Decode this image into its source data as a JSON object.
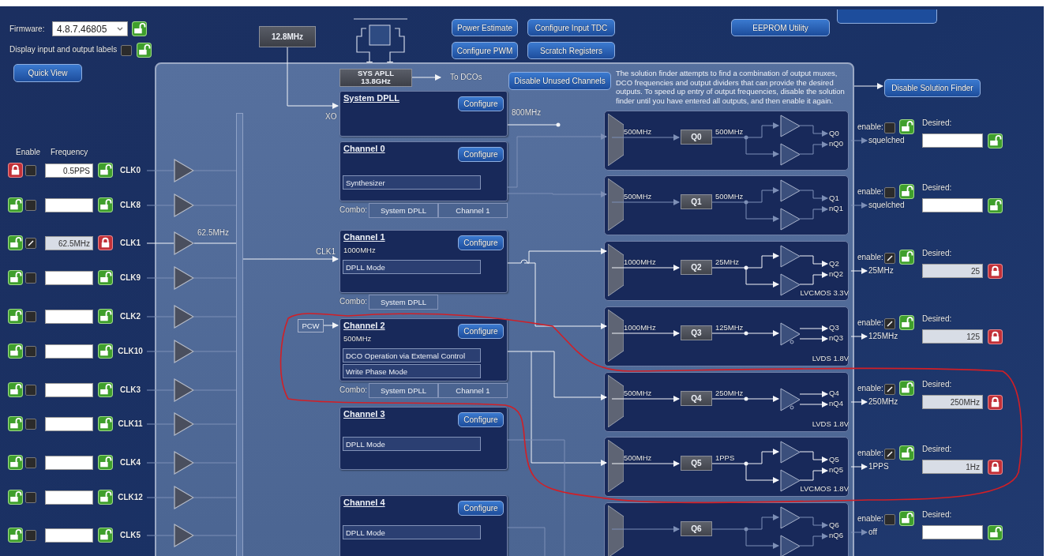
{
  "header": {
    "firmware_label": "Firmware:",
    "firmware_version": "4.8.7.46805",
    "firmware_locked": false,
    "labels_option": "Display input and output labels",
    "labels_checked": false,
    "labels_locked": false,
    "quick_view": "Quick View"
  },
  "top_buttons": [
    "Power Estimate",
    "Configure Input TDC",
    "EEPROM Utility",
    "Configure PWM",
    "Scratch Registers"
  ],
  "xo": {
    "frequency": "12.8MHz"
  },
  "sys_apll": {
    "name": "SYS APLL",
    "frequency": "13.8GHz",
    "output": "To DCOs"
  },
  "disable_unused": "Disable Unused Channels",
  "solution_finder": {
    "note": "The solution finder attempts to find a combination of output muxes, DCO frequencies and output dividers that can provide the desired outputs. To speed up entry of output frequencies, disable the solution finder until you have entered all outputs, and then enable it again.",
    "button": "Disable Solution Finder"
  },
  "inputs": {
    "enable_heading": "Enable",
    "frequency_heading": "Frequency",
    "rows": [
      {
        "label": "CLK0",
        "enable_locked": true,
        "enabled": false,
        "frequency": "0.5PPS",
        "frequency_locked": false
      },
      {
        "label": "CLK8",
        "enable_locked": false,
        "enabled": false,
        "frequency_locked": false
      },
      {
        "label": "CLK1",
        "enable_locked": false,
        "enabled": true,
        "frequency": "62.5MHz",
        "frequency_locked": true,
        "buffer_frequency": "62.5MHz"
      },
      {
        "label": "CLK9",
        "enable_locked": false,
        "enabled": false,
        "frequency_locked": false
      },
      {
        "label": "CLK2",
        "enable_locked": false,
        "enabled": false,
        "frequency_locked": false
      },
      {
        "label": "CLK10",
        "enable_locked": false,
        "enabled": false,
        "frequency_locked": false
      },
      {
        "label": "CLK3",
        "enable_locked": false,
        "enabled": false,
        "frequency_locked": false
      },
      {
        "label": "CLK11",
        "enable_locked": false,
        "enabled": false,
        "frequency_locked": false
      },
      {
        "label": "CLK4",
        "enable_locked": false,
        "enabled": false,
        "frequency_locked": false
      },
      {
        "label": "CLK12",
        "enable_locked": false,
        "enabled": false,
        "frequency_locked": false
      },
      {
        "label": "CLK5",
        "enable_locked": false,
        "enabled": false,
        "frequency_locked": false
      }
    ]
  },
  "channels": [
    {
      "title": "System DPLL",
      "configure": "Configure",
      "input": {
        "kind": "wire",
        "label": "XO"
      },
      "output_frequency": "800MHz"
    },
    {
      "title": "Channel 0",
      "configure": "Configure",
      "modes": [
        "Synthesizer"
      ],
      "combo_label": "Combo:",
      "combo": [
        "System DPLL",
        "Channel 1"
      ]
    },
    {
      "title": "Channel 1",
      "configure": "Configure",
      "frequency": "1000MHz",
      "input": {
        "kind": "wire",
        "label": "CLK1"
      },
      "modes": [
        "DPLL Mode"
      ],
      "combo_label": "Combo:",
      "combo": [
        "System DPLL"
      ]
    },
    {
      "title": "Channel 2",
      "configure": "Configure",
      "frequency": "500MHz",
      "input": {
        "kind": "box",
        "label": "PCW"
      },
      "modes": [
        "DCO Operation via External Control",
        "Write Phase Mode"
      ],
      "combo_label": "Combo:",
      "combo": [
        "System DPLL",
        "Channel 1"
      ]
    },
    {
      "title": "Channel 3",
      "configure": "Configure",
      "modes": [
        "DPLL Mode"
      ]
    },
    {
      "title": "Channel 4",
      "configure": "Configure",
      "modes": [
        "DPLL Mode"
      ]
    }
  ],
  "outputs": [
    {
      "name": "Q0",
      "kind": "cmos",
      "mux_frequency": "500MHz",
      "divider_frequency": "500MHz",
      "pins": [
        "Q0",
        "nQ0"
      ],
      "enable_label": "enable:",
      "enabled": false,
      "enable_locked": false,
      "status": "squelched",
      "desired_label": "Desired:",
      "desired_locked": false
    },
    {
      "name": "Q1",
      "kind": "cmos",
      "mux_frequency": "500MHz",
      "divider_frequency": "500MHz",
      "pins": [
        "Q1",
        "nQ1"
      ],
      "enable_label": "enable:",
      "enabled": false,
      "enable_locked": false,
      "status": "squelched",
      "desired_label": "Desired:",
      "desired_locked": false
    },
    {
      "name": "Q2",
      "kind": "cmos",
      "mux_frequency": "1000MHz",
      "divider_frequency": "25MHz",
      "pins": [
        "Q2",
        "nQ2"
      ],
      "format": "LVCMOS 3.3V",
      "enable_label": "enable:",
      "enabled": true,
      "enable_locked": false,
      "status": "25MHz",
      "desired_label": "Desired:",
      "desired": "25",
      "desired_locked": true
    },
    {
      "name": "Q3",
      "kind": "lvds",
      "mux_frequency": "1000MHz",
      "divider_frequency": "125MHz",
      "pins": [
        "Q3",
        "nQ3"
      ],
      "format": "LVDS 1.8V",
      "enable_label": "enable:",
      "enabled": true,
      "enable_locked": false,
      "status": "125MHz",
      "desired_label": "Desired:",
      "desired": "125",
      "desired_locked": true
    },
    {
      "name": "Q4",
      "kind": "lvds",
      "mux_frequency": "500MHz",
      "divider_frequency": "250MHz",
      "pins": [
        "Q4",
        "nQ4"
      ],
      "format": "LVDS 1.8V",
      "enable_label": "enable:",
      "enabled": true,
      "enable_locked": false,
      "status": "250MHz",
      "desired_label": "Desired:",
      "desired": "250MHz",
      "desired_locked": true
    },
    {
      "name": "Q5",
      "kind": "cmos",
      "mux_frequency": "500MHz",
      "divider_frequency": "1PPS",
      "pins": [
        "Q5",
        "nQ5"
      ],
      "format": "LVCMOS 1.8V",
      "enable_label": "enable:",
      "enabled": true,
      "enable_locked": false,
      "status": "1PPS",
      "desired_label": "Desired:",
      "desired": "1Hz",
      "desired_locked": true
    },
    {
      "name": "Q6",
      "kind": "cmos",
      "pins": [
        "Q6",
        "nQ6"
      ],
      "enable_label": "enable:",
      "enabled": false,
      "enable_locked": false,
      "status": "off",
      "desired_label": "Desired:",
      "desired_locked": false
    }
  ]
}
